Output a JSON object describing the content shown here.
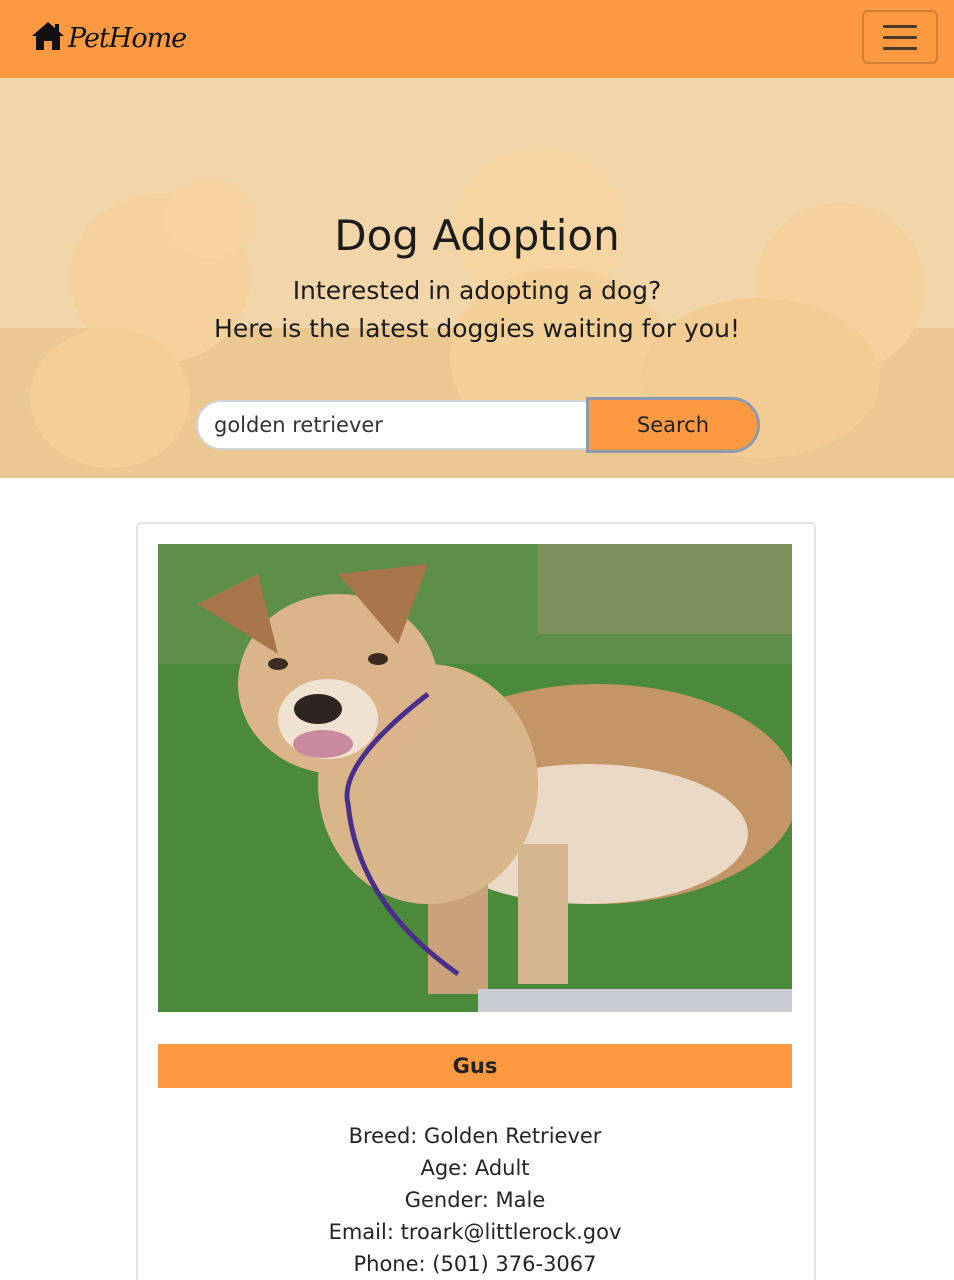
{
  "navbar": {
    "brand": "PetHome",
    "brand_icon": "house-icon",
    "menu_icon": "hamburger-menu-icon",
    "color": "#fd9a41"
  },
  "hero": {
    "title": "Dog Adoption",
    "subtitle_line1": "Interested in adopting a dog?",
    "subtitle_line2": "Here is the latest doggies waiting for you!"
  },
  "search": {
    "value": "golden retriever",
    "button_label": "Search"
  },
  "pet": {
    "name": "Gus",
    "breed": "Breed: Golden Retriever",
    "age": "Age: Adult",
    "gender": "Gender: Male",
    "email": "Email: troark@littlerock.gov",
    "phone": "Phone: (501) 376-3067"
  }
}
